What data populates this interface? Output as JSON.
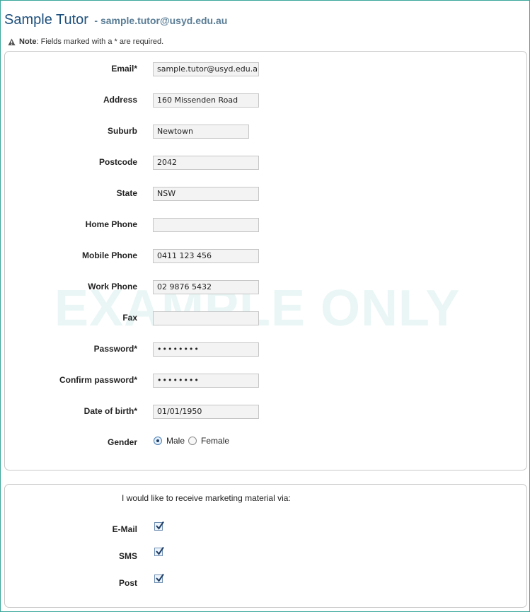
{
  "header": {
    "name": "Sample Tutor",
    "email": "- sample.tutor@usyd.edu.au"
  },
  "note": {
    "label": "Note",
    "text": ": Fields marked with a * are required."
  },
  "watermark": "EXAMPLE ONLY",
  "form": {
    "email": {
      "label": "Email*",
      "value": "sample.tutor@usyd.edu.au"
    },
    "address": {
      "label": "Address",
      "value": "160 Missenden Road"
    },
    "suburb": {
      "label": "Suburb",
      "value": "Newtown"
    },
    "postcode": {
      "label": "Postcode",
      "value": "2042"
    },
    "state": {
      "label": "State",
      "value": "NSW"
    },
    "home_phone": {
      "label": "Home Phone",
      "value": ""
    },
    "mobile_phone": {
      "label": "Mobile Phone",
      "value": "0411 123 456"
    },
    "work_phone": {
      "label": "Work Phone",
      "value": "02 9876 5432"
    },
    "fax": {
      "label": "Fax",
      "value": ""
    },
    "password": {
      "label": "Password*",
      "value": "••••••••"
    },
    "confirm_password": {
      "label": "Confirm password*",
      "value": "••••••••"
    },
    "dob": {
      "label": "Date of birth*",
      "value": "01/01/1950"
    },
    "gender": {
      "label": "Gender",
      "options": [
        "Male",
        "Female"
      ],
      "selected": "Male"
    }
  },
  "marketing": {
    "title": "I would like to receive marketing material via:",
    "options": [
      {
        "label": "E-Mail",
        "checked": true
      },
      {
        "label": "SMS",
        "checked": true
      },
      {
        "label": "Post",
        "checked": true
      }
    ]
  },
  "colors": {
    "frame": "#3aa79a",
    "title": "#1d4f7c",
    "watermark": "#e9f6f5"
  }
}
